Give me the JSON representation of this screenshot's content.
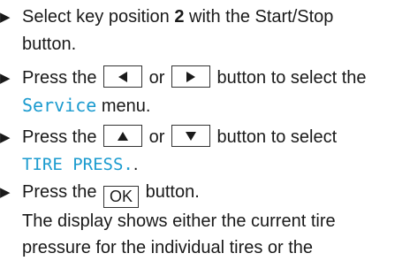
{
  "bullet_glyph": "▶",
  "steps": [
    {
      "line1_before": "Select key position ",
      "line1_bold": "2",
      "line1_after": " with the Start/Stop",
      "line2": "button."
    },
    {
      "line1_before": "Press the ",
      "key_left": "left-arrow-icon",
      "line1_mid": "or",
      "key_right": "right-arrow-icon",
      "line1_after": "button to select the",
      "line2_display": "Service",
      "line2_after": " menu."
    },
    {
      "line1_before": "Press the ",
      "key_up": "up-arrow-icon",
      "line1_mid": "or",
      "key_down": "down-arrow-icon",
      "line1_after": "button to select",
      "line2_display": "TIRE PRESS.",
      "line2_after": "."
    },
    {
      "line1_before": "Press the ",
      "key_ok": "OK",
      "line1_after": " button.",
      "line2": "The display shows either the current tire",
      "line3": "pressure for the individual tires or the"
    }
  ],
  "colors": {
    "text": "#1a1a1a",
    "display_text": "#1b9bcf",
    "key_border": "#333333"
  }
}
